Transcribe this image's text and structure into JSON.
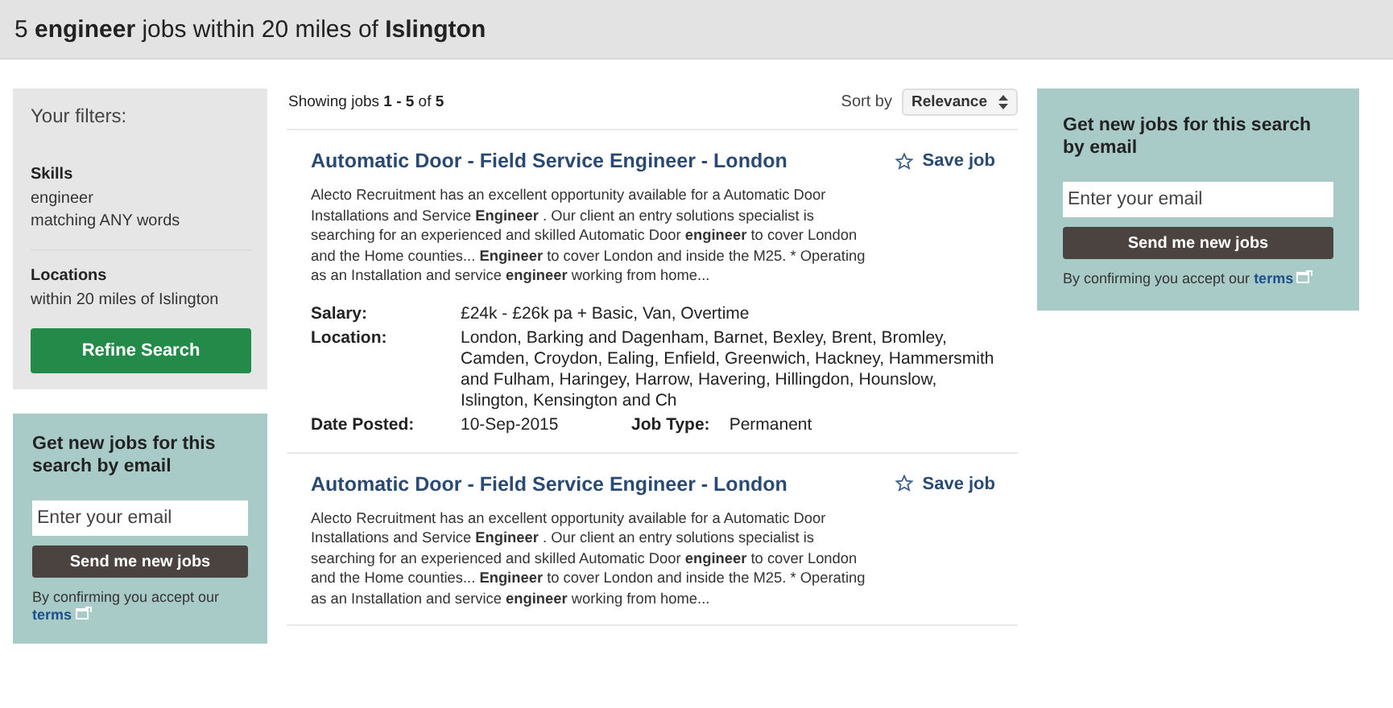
{
  "header": {
    "title": "5 **engineer** jobs within 20 miles of **Islington**"
  },
  "filters": {
    "title": "Your filters:",
    "groups": [
      {
        "label": "Skills",
        "lines": [
          "engineer",
          "matching ANY words"
        ]
      },
      {
        "label": "Locations",
        "lines": [
          "within 20 miles of Islington"
        ]
      }
    ],
    "button": "Refine Search"
  },
  "alerts": [
    {
      "title": "Get new jobs for this search by email",
      "placeholder": "Enter your email",
      "button": "Send me new jobs",
      "note": "By confirming you accept our",
      "link": "terms"
    },
    {
      "title": "Get new jobs for this search by email",
      "placeholder": "Enter your email",
      "button": "Send me new jobs",
      "note": "By confirming you accept our",
      "link": "terms"
    }
  ],
  "results": {
    "summary": "Showing jobs **1 - 5** of **5**",
    "sort_label": "Sort by",
    "sort_value": "Relevance"
  },
  "jobs": [
    {
      "title": "Automatic Door - Field Service Engineer - London",
      "save": "Save job",
      "description": "Alecto Recruitment has an excellent opportunity available for a Automatic Door Installations and Service **Engineer** . Our client an entry solutions specialist is searching for an experienced and skilled Automatic Door **engineer** to cover London and the Home counties... **Engineer** to cover London and inside the M25. * Operating as an Installation and service **engineer** working from home...",
      "details": [
        {
          "label": "Salary:",
          "value": "£24k - £26k pa + Basic, Van, Overtime"
        },
        {
          "label": "Location:",
          "value": "London, Barking and Dagenham, Barnet, Bexley, Brent, Bromley, Camden, Croydon, Ealing, Enfield, Greenwich, Hackney, Hammersmith and Fulham, Haringey, Harrow, Havering, Hillingdon, Hounslow, Islington, Kensington and Ch"
        }
      ],
      "date_label": "Date Posted:",
      "date": "10-Sep-2015",
      "type_label": "Job Type:",
      "type": "Permanent"
    },
    {
      "title": "Automatic Door - Field Service Engineer - London",
      "save": "Save job",
      "description": "Alecto Recruitment has an excellent opportunity available for a Automatic Door Installations and Service **Engineer** . Our client an entry solutions specialist is searching for an experienced and skilled Automatic Door **engineer** to cover London and the Home counties... **Engineer** to cover London and inside the M25. * Operating as an Installation and service **engineer** working from home..."
    }
  ]
}
